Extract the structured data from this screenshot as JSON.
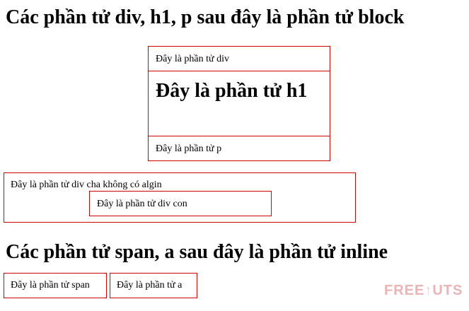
{
  "section1": {
    "heading": "Các phần tử div, h1, p sau đây là phần tử block",
    "div_text": "Đây là phần tử div",
    "h1_text": "Đây là phần tử h1",
    "p_text": "Đây là phần tử p"
  },
  "nested": {
    "parent_text": "Đây là phần tử div cha không có algin",
    "child_text": "Đây là phần tử div con"
  },
  "section2": {
    "heading": "Các phần tử span, a sau đây là phần tử inline",
    "span_text": "Đây là phần tử span",
    "a_text": "Đây là phần tử a"
  },
  "watermark": {
    "text_left": "FREE",
    "text_right": "UTS"
  },
  "colors": {
    "border": "#d10000",
    "watermark": "#e8a6a6"
  }
}
